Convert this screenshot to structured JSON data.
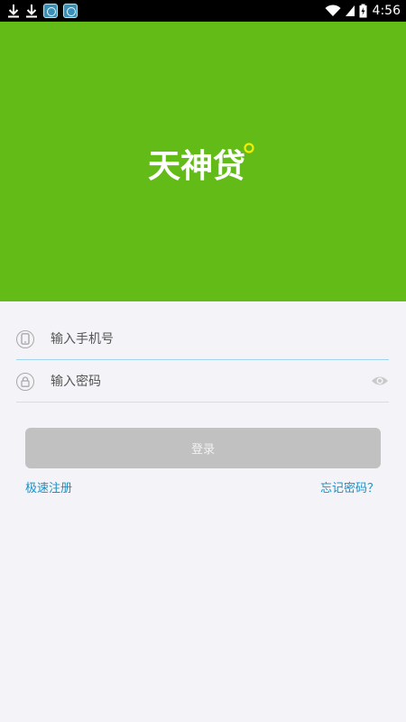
{
  "status_bar": {
    "time": "4:56",
    "icons": [
      "download-icon",
      "download-icon",
      "app-icon",
      "app-icon",
      "wifi-icon",
      "signal-icon",
      "battery-icon"
    ]
  },
  "hero": {
    "logo_text": "天神贷",
    "background_color": "#62bb17"
  },
  "form": {
    "phone_placeholder": "输入手机号",
    "phone_value": "",
    "password_placeholder": "输入密码",
    "password_value": "",
    "login_label": "登录"
  },
  "links": {
    "register": "极速注册",
    "forgot_password": "忘记密码？"
  }
}
